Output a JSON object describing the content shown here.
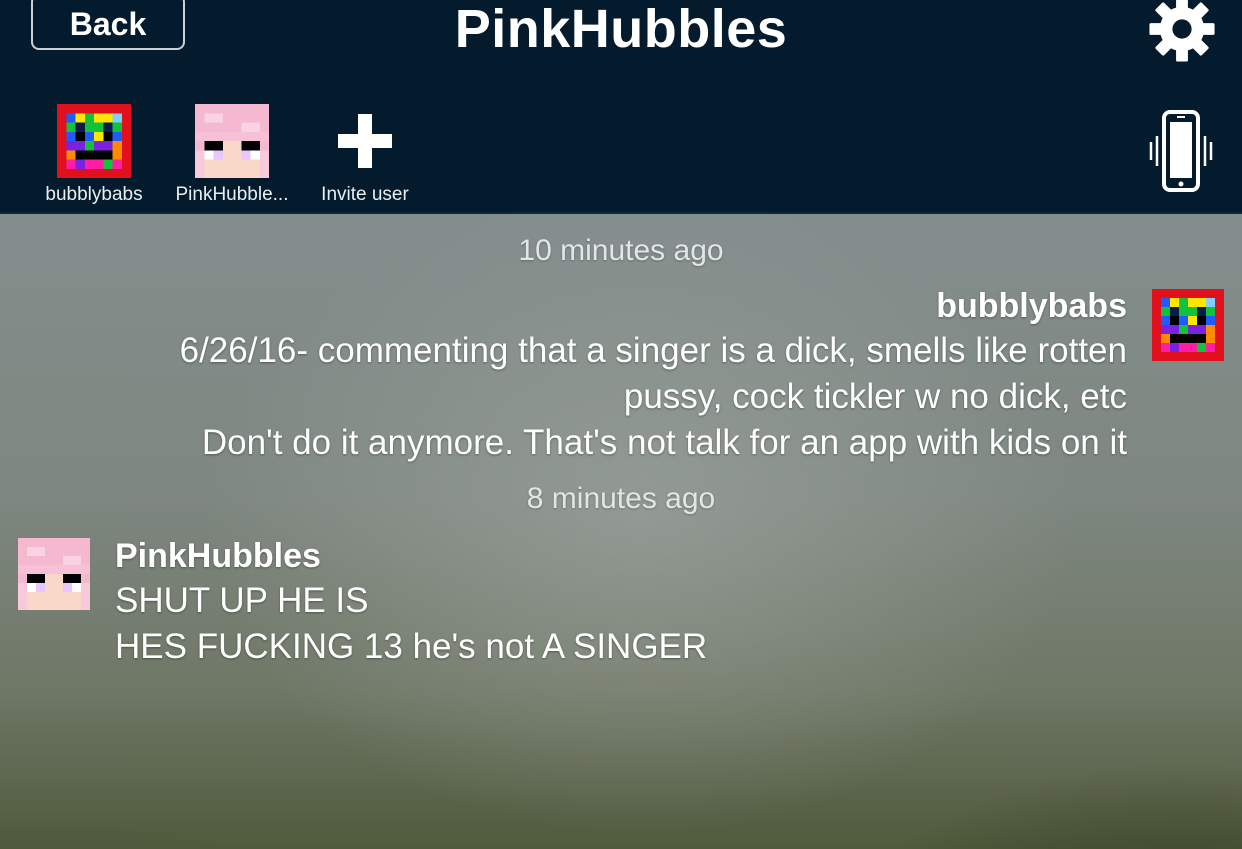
{
  "header": {
    "back_label": "Back",
    "title": "PinkHubbles",
    "settings_icon": "gear-icon"
  },
  "members": [
    {
      "label": "bubblybabs",
      "icon": "rainbow-pixel-avatar"
    },
    {
      "label": "PinkHubble...",
      "icon": "pink-hair-pixel-avatar"
    },
    {
      "label": "Invite user",
      "icon": "plus-icon"
    }
  ],
  "vibrate_icon": "phone-vibrate-icon",
  "messages": [
    {
      "timestamp": "10 minutes ago",
      "sender": "bubblybabs",
      "side": "right",
      "lines": [
        "6/26/16- commenting that a singer is a dick, smells like rotten",
        "pussy, cock tickler w no dick, etc",
        "Don't do it anymore.  That's not talk for an app with kids on it"
      ]
    },
    {
      "timestamp": "8 minutes ago",
      "sender": "PinkHubbles",
      "side": "left",
      "lines": [
        "SHUT UP HE IS",
        "HES FUCKING 13 he's not A SINGER"
      ]
    }
  ],
  "colors": {
    "header_bg": "#041b2e",
    "text": "#ffffff"
  }
}
